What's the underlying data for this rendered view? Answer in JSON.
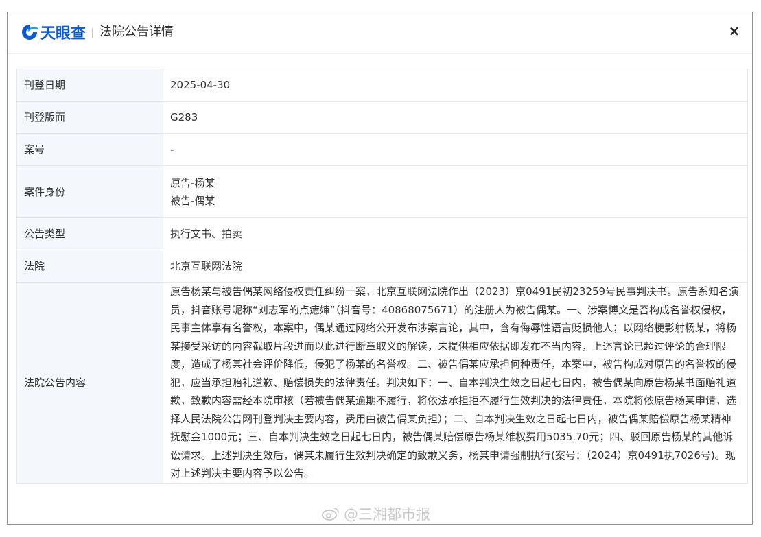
{
  "header": {
    "brand": "天眼查",
    "title": "法院公告详情",
    "close_label": "×",
    "brand_color": "#0a5bd8"
  },
  "rows": [
    {
      "key": "刊登日期",
      "value": "2025-04-30"
    },
    {
      "key": "刊登版面",
      "value": "G283"
    },
    {
      "key": "案号",
      "value": "-"
    },
    {
      "key": "案件身份",
      "parties": [
        "原告-杨某",
        "被告-偶某"
      ]
    },
    {
      "key": "公告类型",
      "value": "执行文书、拍卖"
    },
    {
      "key": "法院",
      "value": "北京互联网法院"
    },
    {
      "key": "法院公告内容",
      "value": "原告杨某与被告偶某网络侵权责任纠纷一案，北京互联网法院作出（2023）京0491民初23259号民事判决书。原告系知名演员，抖音账号昵称“刘志军的点痣婶”（抖音号：40868075671）的注册人为被告偶某。一、涉案博文是否构成名誉权侵权，民事主体享有名誉权，本案中，偶某通过网络公开发布涉案言论，其中，含有侮辱性语言贬损他人；以网络梗影射杨某，将杨某接受采访的内容截取片段进而以此进行断章取义的解读，未提供相应依据即发布不当内容，上述言论已超过评论的合理限度，造成了杨某社会评价降低，侵犯了杨某的名誉权。二、被告偶某应承担何种责任，本案中，被告构成对原告的名誉权的侵犯，应当承担赔礼道歉、赔偿损失的法律责任。判决如下：一、自本判决生效之日起七日内，被告偶某向原告杨某书面赔礼道歉，致歉内容需经本院审核（若被告偶某逾期不履行，将依法承担拒不履行生效判决的法律责任，本院将依原告杨某申请，选择人民法院公告网刊登判决主要内容，费用由被告偶某负担）；二、自本判决生效之日起七日内，被告偶某赔偿原告杨某精神抚慰金1000元；三、自本判决生效之日起七日内，被告偶某赔偿原告杨某维权费用5035.70元；四、驳回原告杨某的其他诉讼请求。上述判决生效后，偶某未履行生效判决确定的致歉义务，杨某申请强制执行(案号：（2024）京0491执7026号)。现对上述判决主要内容予以公告。"
    }
  ],
  "watermark": "@三湘都市报"
}
